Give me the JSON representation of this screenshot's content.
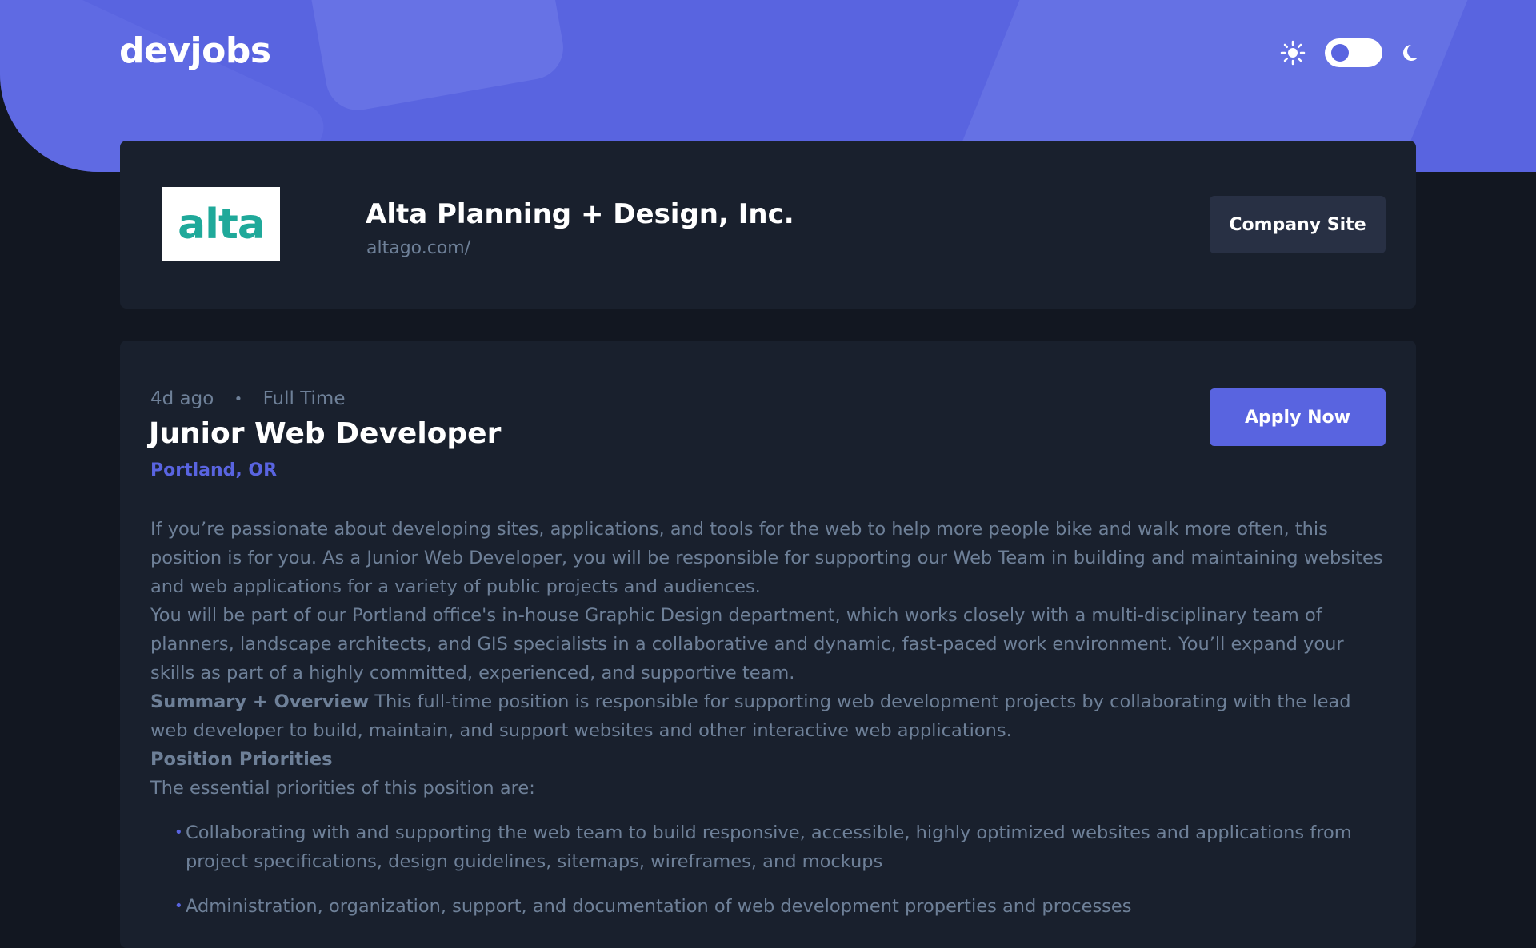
{
  "header": {
    "logo": "devjobs",
    "theme": {
      "mode": "dark",
      "sun_icon": "sun-icon",
      "moon_icon": "moon-icon"
    }
  },
  "company": {
    "logo_text": "alta",
    "name": "Alta Planning + Design, Inc.",
    "url": "altago.com/",
    "site_button": "Company Site"
  },
  "job": {
    "posted": "4d ago",
    "separator": "•",
    "contract": "Full Time",
    "title": "Junior Web Developer",
    "location": "Portland, OR",
    "apply_button": "Apply Now",
    "description": {
      "p1": "If you’re passionate about developing sites, applications, and tools for the web to help more people bike and walk more often, this position is for you. As a Junior Web Developer, you will be responsible for supporting our Web Team in building and maintaining websites and web applications for a variety of public projects and audiences.",
      "p2": "You will be part of our Portland office's in-house Graphic Design department, which works closely with a multi-disciplinary team of planners, landscape architects, and GIS specialists in a collaborative and dynamic, fast-paced work environment. You’ll expand your skills as part of a highly committed, experienced, and supportive team.",
      "summary_heading": "Summary + Overview",
      "summary_text": "This full-time position is responsible for supporting web development projects by collaborating with the lead web developer to build, maintain, and support websites and other interactive web applications.",
      "priorities_heading": "Position Priorities",
      "priorities_intro": "The essential priorities of this position are:",
      "bullet": "•",
      "priorities": [
        "Collaborating with and supporting the web team to build responsive, accessible, highly optimized websites and applications from project specifications, design guidelines, sitemaps, wireframes, and mockups",
        "Administration, organization, support, and documentation of web development properties and processes"
      ]
    }
  },
  "colors": {
    "background": "#121721",
    "header": "#5964e0",
    "card": "#19202d",
    "accent": "#5964e0",
    "secondary_button": "#283044",
    "muted_text": "#6e8098",
    "logo_teal": "#1fa99a"
  }
}
